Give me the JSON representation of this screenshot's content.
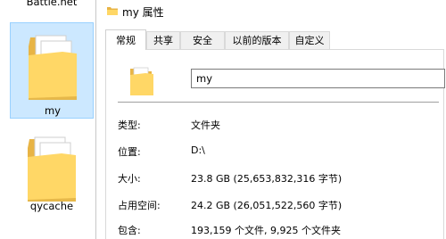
{
  "desktop": {
    "top_label": "Battle.net",
    "items": [
      {
        "label": "my"
      },
      {
        "label": "qycache"
      }
    ]
  },
  "window": {
    "title": "my 属性"
  },
  "tabs": [
    "常规",
    "共享",
    "安全",
    "以前的版本",
    "自定义"
  ],
  "general": {
    "name_value": "my",
    "properties": [
      {
        "label": "类型:",
        "value": "文件夹"
      },
      {
        "label": "位置:",
        "value": "D:\\"
      },
      {
        "label": "大小:",
        "value": "23.8 GB (25,653,832,316 字节)"
      },
      {
        "label": "占用空间:",
        "value": "24.2 GB (26,051,522,560 字节)"
      },
      {
        "label": "包含:",
        "value": "193,159 个文件, 9,925 个文件夹"
      }
    ]
  },
  "colors": {
    "folder_front": "#ffd766",
    "folder_back": "#e8b445",
    "selection_bg": "#cce8ff",
    "selection_border": "#99d1ff"
  }
}
